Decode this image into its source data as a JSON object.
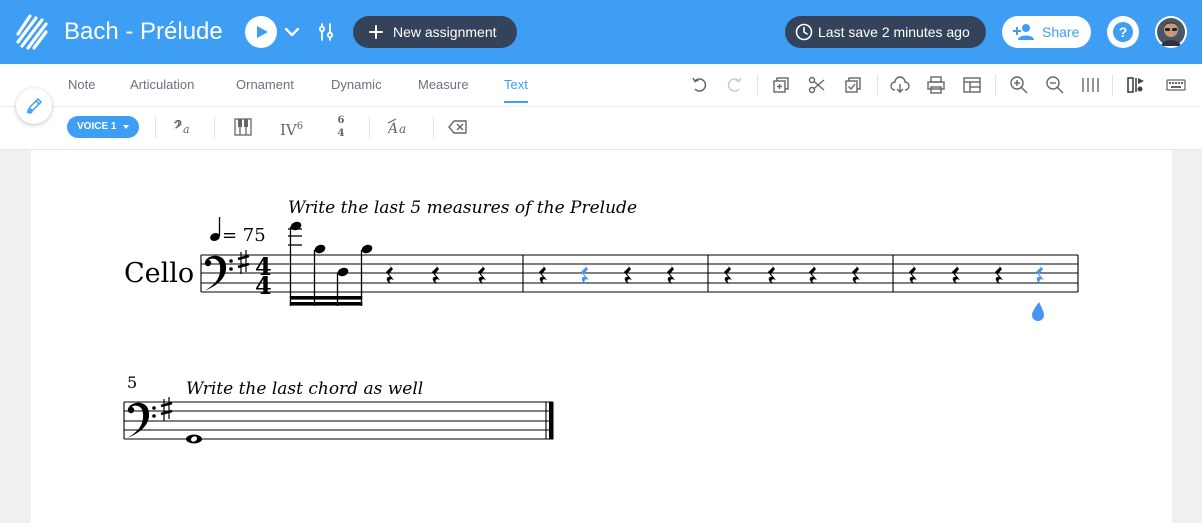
{
  "app": {
    "title": "Bach - Prélude",
    "new_assignment_label": "New assignment",
    "save_status": "Last save 2 minutes ago",
    "share_label": "Share",
    "help_label": "?"
  },
  "tabs": [
    {
      "label": "Note",
      "active": false
    },
    {
      "label": "Articulation",
      "active": false
    },
    {
      "label": "Ornament",
      "active": false
    },
    {
      "label": "Dynamic",
      "active": false
    },
    {
      "label": "Measure",
      "active": false
    },
    {
      "label": "Text",
      "active": true
    }
  ],
  "toolbar_icons": [
    "undo-icon",
    "redo-icon",
    "copy-icon",
    "cut-icon",
    "paste-icon",
    "export-icon",
    "print-icon",
    "layout-icon",
    "zoom-in-icon",
    "zoom-out-icon",
    "barlines-icon",
    "score-icon",
    "keyboard-icon"
  ],
  "text_tools": {
    "voice_label": "VOICE 1",
    "roman_numeral": "IV",
    "roman_numeral_sup": "6",
    "figured_bass_top": "6",
    "figured_bass_bottom": "4"
  },
  "score": {
    "instrument": "Cello",
    "tempo": "= 75",
    "instruction_1": "Write the last 5 measures of the Prelude",
    "instruction_2": "Write the last chord as well",
    "system_2_measure_number": "5",
    "clef": "bass",
    "key_signature": "1 sharp",
    "time_signature": {
      "top": "4",
      "bottom": "4"
    }
  },
  "colors": {
    "topbar": "#3d9ef4",
    "dark_pill": "#35435a",
    "accent": "#3d9ef4",
    "selected_rest": "#4b95f2"
  }
}
